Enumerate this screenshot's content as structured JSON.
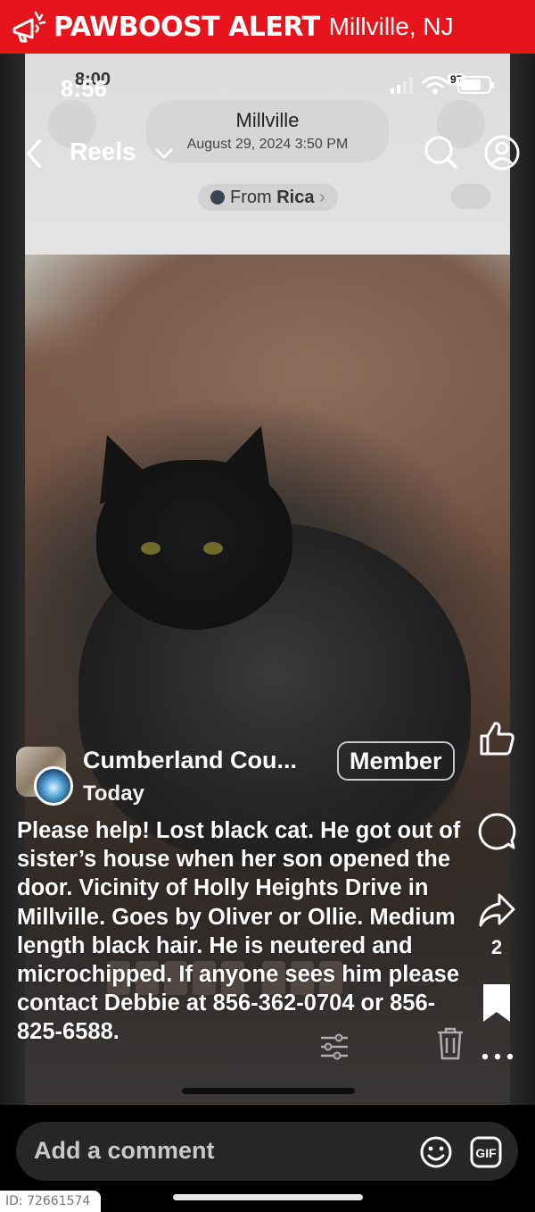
{
  "alert_banner": {
    "brand": "PAWBOOST ALERT",
    "location": "Millville, NJ",
    "icon": "megaphone-icon",
    "color": "#e8141b"
  },
  "background_screenshot": {
    "title": "Millville",
    "date": "August 29, 2024  3:50 PM",
    "from_label": "From",
    "from_name": "Rica",
    "time": "8:00"
  },
  "status_bar": {
    "time": "8:56",
    "battery": "97",
    "icons": [
      "signal-icon",
      "wifi-icon",
      "battery-icon"
    ]
  },
  "nav": {
    "title": "Reels",
    "icons": [
      "back-chevron-icon",
      "chevron-down-icon",
      "search-icon",
      "profile-icon"
    ]
  },
  "post": {
    "group_name": "Cumberland Cou...",
    "member_badge": "Member",
    "time": "Today",
    "text": "Please help! Lost black cat. He got out of sister’s  house when her son opened the door. Vicinity of Holly Heights Drive in Millville. Goes by Oliver or Ollie. Medium length black hair. He is neutered and microchipped. If anyone sees him please contact Debbie at 856-362-0704 or 856-825-6588."
  },
  "actions": {
    "icons": [
      "like-icon",
      "comment-icon",
      "share-icon",
      "bookmark-icon",
      "more-icon"
    ],
    "share_count": "2"
  },
  "comment": {
    "placeholder": "Add a comment",
    "icons": [
      "emoji-icon",
      "gif-icon"
    ],
    "gif_label": "GIF"
  },
  "footer": {
    "id_label": "ID: 72661574"
  }
}
